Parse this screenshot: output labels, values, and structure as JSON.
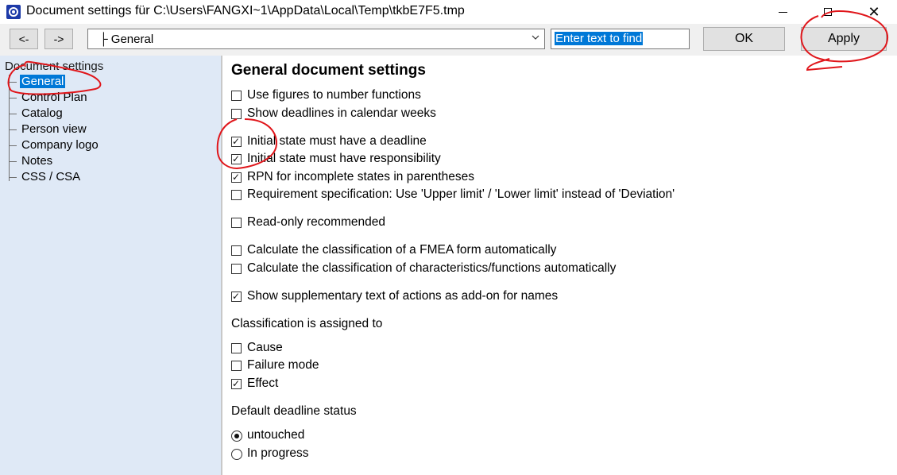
{
  "window": {
    "title": "Document settings für C:\\Users\\FANGXI~1\\AppData\\Local\\Temp\\tkbE7F5.tmp"
  },
  "toolbar": {
    "back_label": "<-",
    "forward_label": "->",
    "page_select_value": "├ General",
    "search_value": "Enter text to find",
    "ok_label": "OK",
    "apply_label": "Apply"
  },
  "sidebar": {
    "root": "Document settings",
    "items": [
      {
        "label": "General",
        "selected": true
      },
      {
        "label": "Control Plan"
      },
      {
        "label": "Catalog"
      },
      {
        "label": "Person view"
      },
      {
        "label": "Company logo"
      },
      {
        "label": "Notes"
      },
      {
        "label": "CSS / CSA"
      }
    ]
  },
  "main": {
    "heading": "General document settings",
    "options": [
      {
        "label": "Use figures to number functions",
        "checked": false
      },
      {
        "label": "Show deadlines in calendar weeks",
        "checked": false
      },
      {
        "label": "Initial state must have a deadline",
        "checked": true
      },
      {
        "label": "Initial state must have responsibility",
        "checked": true
      },
      {
        "label": "RPN for incomplete states in parentheses",
        "checked": true
      },
      {
        "label": "Requirement specification: Use 'Upper limit' / 'Lower limit' instead of 'Deviation'",
        "checked": false
      },
      {
        "label": "Read-only recommended",
        "checked": false
      },
      {
        "label": "Calculate the classification of a FMEA form automatically",
        "checked": false
      },
      {
        "label": "Calculate the classification of characteristics/functions automatically",
        "checked": false
      },
      {
        "label": "Show supplementary text of actions as add-on for names",
        "checked": true
      }
    ],
    "classification_label": "Classification is assigned to",
    "classification": [
      {
        "label": "Cause",
        "checked": false
      },
      {
        "label": "Failure mode",
        "checked": false
      },
      {
        "label": "Effect",
        "checked": true
      }
    ],
    "deadline_status_label": "Default deadline status",
    "deadline_status": [
      {
        "label": "untouched",
        "selected": true
      },
      {
        "label": "In progress",
        "selected": false
      }
    ]
  },
  "colors": {
    "sidebar_bg": "#dfe9f6",
    "selection": "#0078d7",
    "annotation": "#e0161b"
  }
}
